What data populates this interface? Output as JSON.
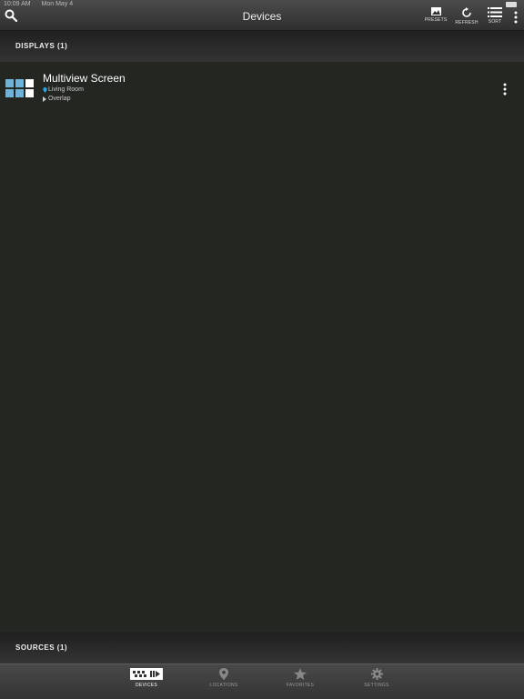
{
  "status_bar": {
    "time": "10:09 AM",
    "date": "Mon May 4"
  },
  "header": {
    "title": "Devices",
    "actions": [
      {
        "label": "PRESETS",
        "icon": "image-icon"
      },
      {
        "label": "REFRESH",
        "icon": "refresh-icon"
      },
      {
        "label": "SORT",
        "icon": "list-icon"
      }
    ]
  },
  "displays_section": {
    "label": "DISPLAYS (1)",
    "devices": [
      {
        "name": "Multiview Screen",
        "location": "Living Room",
        "mode": "Overlap",
        "icon": "multiview-grid-icon"
      }
    ]
  },
  "sources_section": {
    "label": "SOURCES (1)"
  },
  "tabs": [
    {
      "label": "DEVICES",
      "icon": "devices-icon",
      "active": true
    },
    {
      "label": "LOCATIONS",
      "icon": "location-pin-icon",
      "active": false
    },
    {
      "label": "FAVORITES",
      "icon": "star-icon",
      "active": false
    },
    {
      "label": "SETTINGS",
      "icon": "gear-icon",
      "active": false
    }
  ],
  "colors": {
    "background": "#242622",
    "accent": "#6fb4d8",
    "location_pin": "#2fa6e0"
  }
}
